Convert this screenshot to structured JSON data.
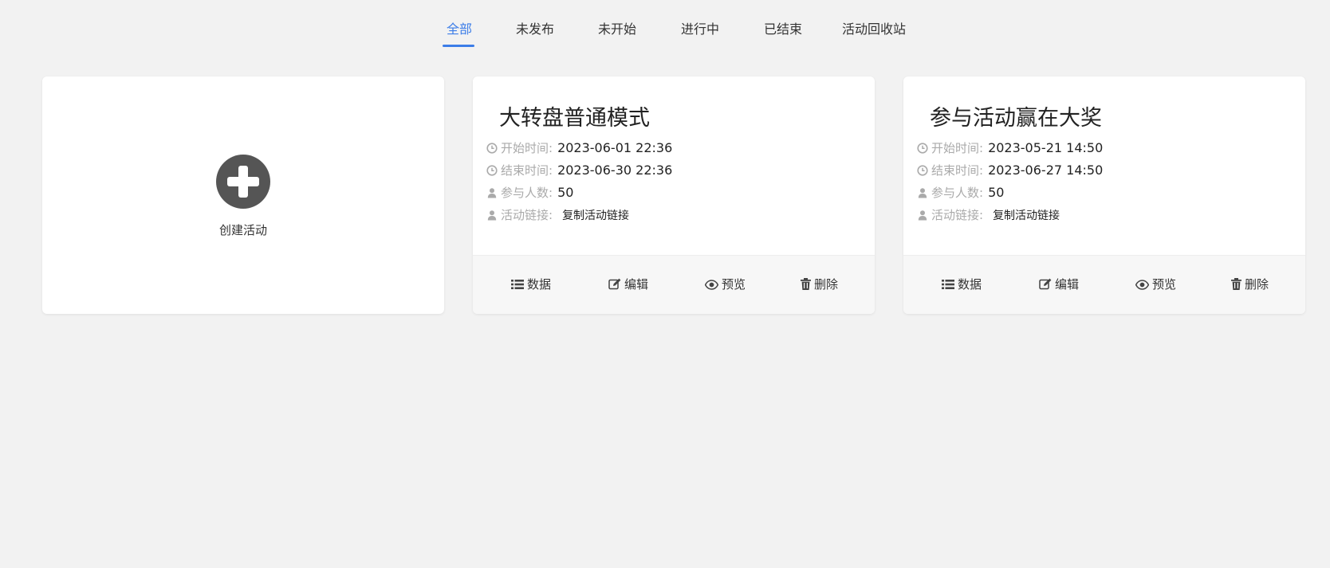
{
  "tabs": [
    {
      "label": "全部",
      "active": true
    },
    {
      "label": "未发布",
      "active": false
    },
    {
      "label": "未开始",
      "active": false
    },
    {
      "label": "进行中",
      "active": false
    },
    {
      "label": "已结束",
      "active": false
    },
    {
      "label": "活动回收站",
      "active": false
    }
  ],
  "create": {
    "label": "创建活动",
    "icon": "plus-circle-icon"
  },
  "activities": [
    {
      "title": "大转盘普通模式",
      "start_label": "开始时间:",
      "start_value": "2023-06-01 22:36",
      "end_label": "结束时间:",
      "end_value": "2023-06-30 22:36",
      "participants_label": "参与人数:",
      "participants_value": "50",
      "link_label": "活动链接:",
      "link_value": "复制活动链接"
    },
    {
      "title": "参与活动赢在大奖",
      "start_label": "开始时间:",
      "start_value": "2023-05-21 14:50",
      "end_label": "结束时间:",
      "end_value": "2023-06-27 14:50",
      "participants_label": "参与人数:",
      "participants_value": "50",
      "link_label": "活动链接:",
      "link_value": "复制活动链接"
    }
  ],
  "actions": {
    "data_label": "数据",
    "edit_label": "编辑",
    "preview_label": "预览",
    "delete_label": "删除"
  },
  "colors": {
    "accent": "#3c7de8",
    "background": "#f2f2f2",
    "card": "#ffffff",
    "footer": "#f7f7f7",
    "muted": "#aaaaaa"
  }
}
